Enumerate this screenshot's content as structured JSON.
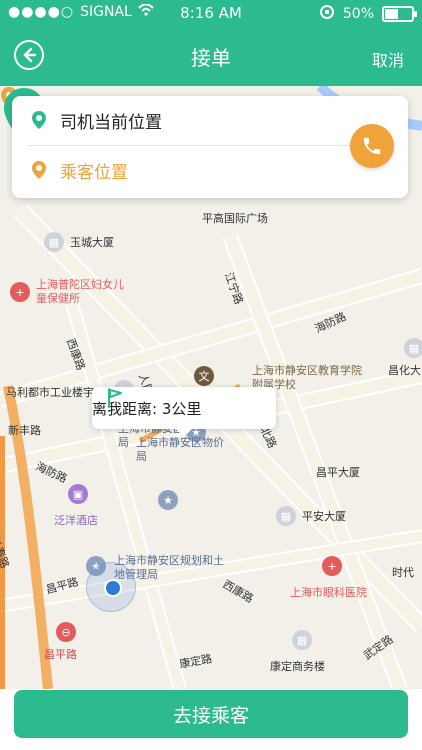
{
  "status": {
    "carrier": "SIGNAL",
    "time": "8:16 AM",
    "battery": "50%"
  },
  "header": {
    "title": "接单",
    "cancel": "取消"
  },
  "panel": {
    "driver_location": "司机当前位置",
    "passenger_location": "乘客位置"
  },
  "bubble": {
    "distance_text": "离我距离: 3公里"
  },
  "bottom": {
    "go_label": "去接乘客"
  },
  "map": {
    "labels": [
      "平高国际广场",
      "玉城大厦",
      "江宁路",
      "海防路",
      "上海普陀区妇女儿童保健所",
      "西康路",
      "人民路",
      "马利都市工业楼宇",
      "上海市静安区教育学院附属学校",
      "新丰路",
      "昌化大",
      "上海市静安区民政局",
      "上海市静安区物价局",
      "泛洋酒店",
      "海防路",
      "陕西北路",
      "昌平大厦",
      "平安大厦",
      "上海市静安区规划和土地管理局",
      "昌平路",
      "上海市眼科医院",
      "时代",
      "西康路",
      "康定路",
      "康定商务楼",
      "武定路",
      "昌平路",
      "长寿路"
    ]
  },
  "colors": {
    "accent": "#2bbb8f",
    "orange": "#f0a33a"
  }
}
